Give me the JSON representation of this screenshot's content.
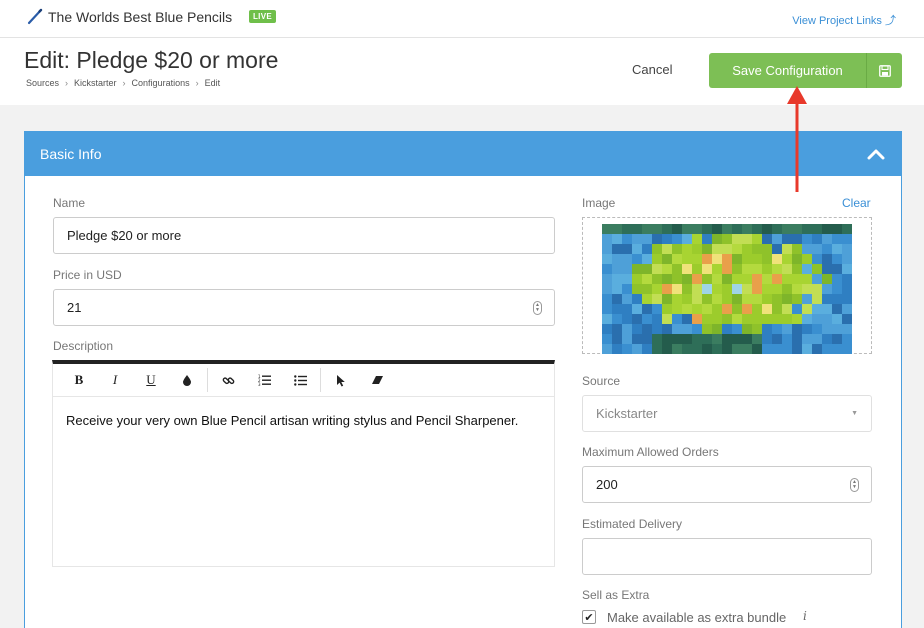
{
  "topbar": {
    "project_name": "The Worlds Best Blue Pencils",
    "badge": "LIVE",
    "project_links": "View Project Links ⤴"
  },
  "header": {
    "title": "Edit: Pledge $20 or more",
    "breadcrumbs": [
      "Sources",
      "Kickstarter",
      "Configurations",
      "Edit"
    ],
    "cancel_label": "Cancel",
    "save_label": "Save Configuration"
  },
  "panel": {
    "title": "Basic Info",
    "name_label": "Name",
    "name_value": "Pledge $20 or more",
    "price_label": "Price in USD",
    "price_value": "21",
    "description_label": "Description",
    "description_text": "Receive your very own Blue Pencil artisan writing stylus and Pencil Sharpener.",
    "toolbar": {
      "bold": "B",
      "italic": "I",
      "underline": "U"
    },
    "image_label": "Image",
    "clear_label": "Clear",
    "source_label": "Source",
    "source_value": "Kickstarter",
    "max_orders_label": "Maximum Allowed Orders",
    "max_orders_value": "200",
    "delivery_label": "Estimated Delivery",
    "delivery_value": "",
    "extra_label": "Sell as Extra",
    "extra_checkbox_label": "Make available as extra bundle",
    "extra_checked": true
  },
  "colors": {
    "accent": "#4a9ede",
    "save": "#7dbf55",
    "live": "#6fbf4a",
    "arrow": "#e8392b",
    "link": "#3a8fd6"
  }
}
